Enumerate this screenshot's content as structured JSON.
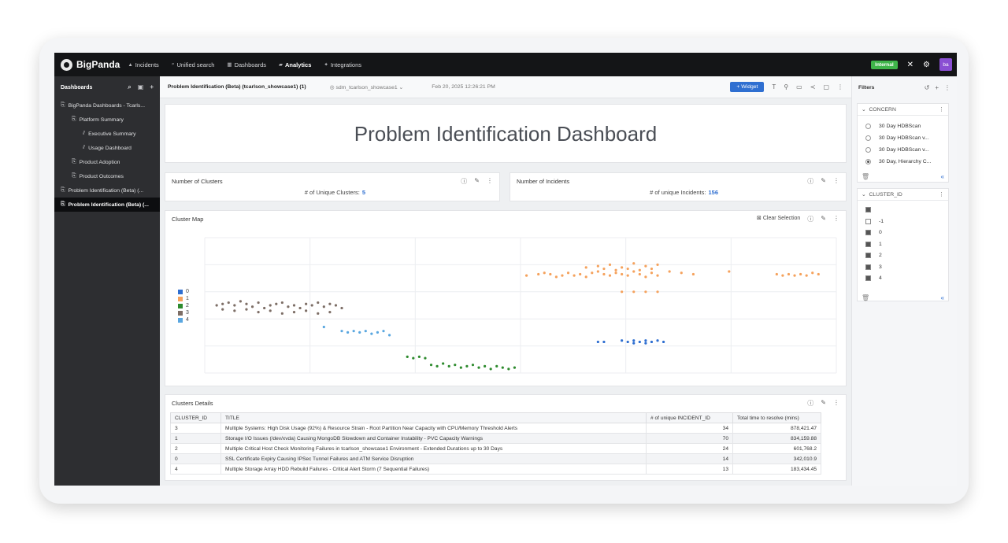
{
  "topbar": {
    "brand": "BigPanda",
    "nav": [
      {
        "label": "Incidents",
        "icon": "▲",
        "active": false
      },
      {
        "label": "Unified search",
        "icon": "⌕",
        "active": false
      },
      {
        "label": "Dashboards",
        "icon": "▦",
        "active": false
      },
      {
        "label": "Analytics",
        "icon": "▰",
        "active": true
      },
      {
        "label": "Integrations",
        "icon": "✦",
        "active": false
      }
    ],
    "environment_badge": "Internal",
    "avatar_initials": "ba"
  },
  "sidebar": {
    "title": "Dashboards",
    "items": [
      {
        "label": "BigPanda Dashboards - Tcarls...",
        "indent": 0,
        "active": false
      },
      {
        "label": "Platform Summary",
        "indent": 1,
        "active": false
      },
      {
        "label": "Executive Summary",
        "indent": 2,
        "active": false
      },
      {
        "label": "Usage Dashboard",
        "indent": 2,
        "active": false
      },
      {
        "label": "Product Adoption",
        "indent": 1,
        "active": false
      },
      {
        "label": "Product Outcomes",
        "indent": 1,
        "active": false
      },
      {
        "label": "Problem Identification (Beta) (...",
        "indent": 0,
        "active": false
      },
      {
        "label": "Problem Identification (Beta) (...",
        "indent": 0,
        "active": true
      }
    ]
  },
  "header": {
    "title": "Problem Identification (Beta) (tcarlson_showcase1) (1)",
    "source": "sdm_tcarlson_showcase1",
    "date": "Feb 20, 2025 12:26:21 PM",
    "widget_button": "+ Widget"
  },
  "dashboard_title": "Problem Identification Dashboard",
  "kpis": {
    "clusters": {
      "title": "Number of Clusters",
      "label": "# of Unique Clusters:",
      "value": "5"
    },
    "incidents": {
      "title": "Number of Incidents",
      "label": "# of unique Incidents:",
      "value": "156"
    }
  },
  "cluster_map": {
    "title": "Cluster Map",
    "clear_selection": "Clear Selection",
    "legend": [
      {
        "label": "0",
        "color": "#2f6fd1"
      },
      {
        "label": "1",
        "color": "#f5a25d"
      },
      {
        "label": "2",
        "color": "#2e8b2e"
      },
      {
        "label": "3",
        "color": "#7d6e66"
      },
      {
        "label": "4",
        "color": "#5aa7e0"
      }
    ]
  },
  "chart_data": {
    "type": "scatter",
    "xlim": [
      0,
      100
    ],
    "ylim": [
      0,
      100
    ],
    "grid": true,
    "series": [
      {
        "name": "0",
        "color": "#2f6fd1",
        "points": [
          [
            66,
            23
          ],
          [
            67,
            23
          ],
          [
            70,
            24
          ],
          [
            71,
            23
          ],
          [
            72,
            24
          ],
          [
            73,
            23
          ],
          [
            74,
            24
          ],
          [
            75,
            23
          ],
          [
            76,
            24
          ],
          [
            77,
            23
          ],
          [
            72,
            22
          ],
          [
            74,
            22
          ]
        ]
      },
      {
        "name": "1",
        "color": "#f5a25d",
        "points": [
          [
            54,
            72
          ],
          [
            56,
            73
          ],
          [
            58,
            73
          ],
          [
            60,
            72
          ],
          [
            57,
            74
          ],
          [
            59,
            71
          ],
          [
            61,
            74
          ],
          [
            62,
            72
          ],
          [
            63,
            73
          ],
          [
            64,
            71
          ],
          [
            65,
            74
          ],
          [
            66,
            75
          ],
          [
            67,
            73
          ],
          [
            68,
            72
          ],
          [
            69,
            74
          ],
          [
            70,
            73
          ],
          [
            71,
            72
          ],
          [
            72,
            75
          ],
          [
            73,
            73
          ],
          [
            74,
            71
          ],
          [
            75,
            74
          ],
          [
            76,
            72
          ],
          [
            66,
            79
          ],
          [
            68,
            80
          ],
          [
            70,
            78
          ],
          [
            72,
            81
          ],
          [
            74,
            79
          ],
          [
            76,
            80
          ],
          [
            64,
            78
          ],
          [
            67,
            77
          ],
          [
            69,
            76
          ],
          [
            71,
            77
          ],
          [
            73,
            76
          ],
          [
            75,
            77
          ],
          [
            78,
            75
          ],
          [
            80,
            74
          ],
          [
            82,
            73
          ],
          [
            70,
            60
          ],
          [
            72,
            60
          ],
          [
            74,
            60
          ],
          [
            76,
            60
          ],
          [
            88,
            75
          ],
          [
            96,
            73
          ],
          [
            97,
            72
          ],
          [
            98,
            73
          ],
          [
            99,
            72
          ],
          [
            100,
            73
          ],
          [
            101,
            72
          ],
          [
            102,
            74
          ],
          [
            103,
            73
          ]
        ]
      },
      {
        "name": "2",
        "color": "#2e8b2e",
        "points": [
          [
            34,
            12
          ],
          [
            35,
            11
          ],
          [
            36,
            12
          ],
          [
            37,
            11
          ],
          [
            38,
            6
          ],
          [
            39,
            5
          ],
          [
            40,
            7
          ],
          [
            41,
            5
          ],
          [
            42,
            6
          ],
          [
            43,
            4
          ],
          [
            44,
            5
          ],
          [
            45,
            6
          ],
          [
            46,
            4
          ],
          [
            47,
            5
          ],
          [
            48,
            3
          ],
          [
            49,
            5
          ],
          [
            50,
            4
          ],
          [
            51,
            3
          ],
          [
            52,
            4
          ]
        ]
      },
      {
        "name": "3",
        "color": "#7d6e66",
        "points": [
          [
            2,
            50
          ],
          [
            3,
            51
          ],
          [
            4,
            52
          ],
          [
            5,
            50
          ],
          [
            6,
            53
          ],
          [
            7,
            51
          ],
          [
            8,
            49
          ],
          [
            9,
            52
          ],
          [
            10,
            48
          ],
          [
            11,
            50
          ],
          [
            12,
            51
          ],
          [
            13,
            52
          ],
          [
            14,
            49
          ],
          [
            15,
            50
          ],
          [
            16,
            48
          ],
          [
            17,
            51
          ],
          [
            18,
            50
          ],
          [
            19,
            52
          ],
          [
            20,
            49
          ],
          [
            21,
            51
          ],
          [
            22,
            50
          ],
          [
            23,
            48
          ],
          [
            3,
            47
          ],
          [
            5,
            46
          ],
          [
            7,
            47
          ],
          [
            9,
            45
          ],
          [
            11,
            46
          ],
          [
            13,
            44
          ],
          [
            15,
            45
          ],
          [
            17,
            46
          ],
          [
            19,
            44
          ],
          [
            21,
            45
          ]
        ]
      },
      {
        "name": "4",
        "color": "#5aa7e0",
        "points": [
          [
            20,
            34
          ],
          [
            23,
            31
          ],
          [
            24,
            30
          ],
          [
            25,
            31
          ],
          [
            26,
            30
          ],
          [
            27,
            31
          ],
          [
            28,
            29
          ],
          [
            29,
            30
          ],
          [
            30,
            31
          ],
          [
            31,
            28
          ]
        ]
      }
    ]
  },
  "clusters_details": {
    "title": "Clusters Details",
    "columns": [
      "CLUSTER_ID",
      "TITLE",
      "# of unique INCIDENT_ID",
      "Total time to resolve (mins)"
    ],
    "rows": [
      [
        "3",
        "Multiple Systems: High Disk Usage (92%) & Resource Strain - Root Partition Near Capacity with CPU/Memory Threshold Alerts",
        "34",
        "878,421.47"
      ],
      [
        "1",
        "Storage I/O Issues (/dev/xvda) Causing MongoDB Slowdown and Container Instability - PVC Capacity Warnings",
        "70",
        "834,159.88"
      ],
      [
        "2",
        "Multiple Critical Host Check Monitoring Failures in tcarlson_showcase1 Environment - Extended Durations up to 30 Days",
        "24",
        "601,768.2"
      ],
      [
        "0",
        "SSL Certificate Expiry Causing IPSec Tunnel Failures and ATM Service Disruption",
        "14",
        "342,010.9"
      ],
      [
        "4",
        "Multiple Storage Array HDD Rebuild Failures - Critical Alert Storm (7 Sequential Failures)",
        "13",
        "183,434.45"
      ]
    ]
  },
  "filters": {
    "title": "Filters",
    "concern": {
      "label": "CONCERN",
      "options": [
        {
          "label": "30 Day HDBScan",
          "selected": false
        },
        {
          "label": "30 Day HDBScan v...",
          "selected": false
        },
        {
          "label": "30 Day HDBScan v...",
          "selected": false
        },
        {
          "label": "30 Day, Hierarchy C...",
          "selected": true
        }
      ]
    },
    "cluster_id": {
      "label": "CLUSTER_ID",
      "options": [
        {
          "label": "-1",
          "checked": false
        },
        {
          "label": "0",
          "checked": true
        },
        {
          "label": "1",
          "checked": true
        },
        {
          "label": "2",
          "checked": true
        },
        {
          "label": "3",
          "checked": true
        },
        {
          "label": "4",
          "checked": true
        }
      ]
    }
  }
}
